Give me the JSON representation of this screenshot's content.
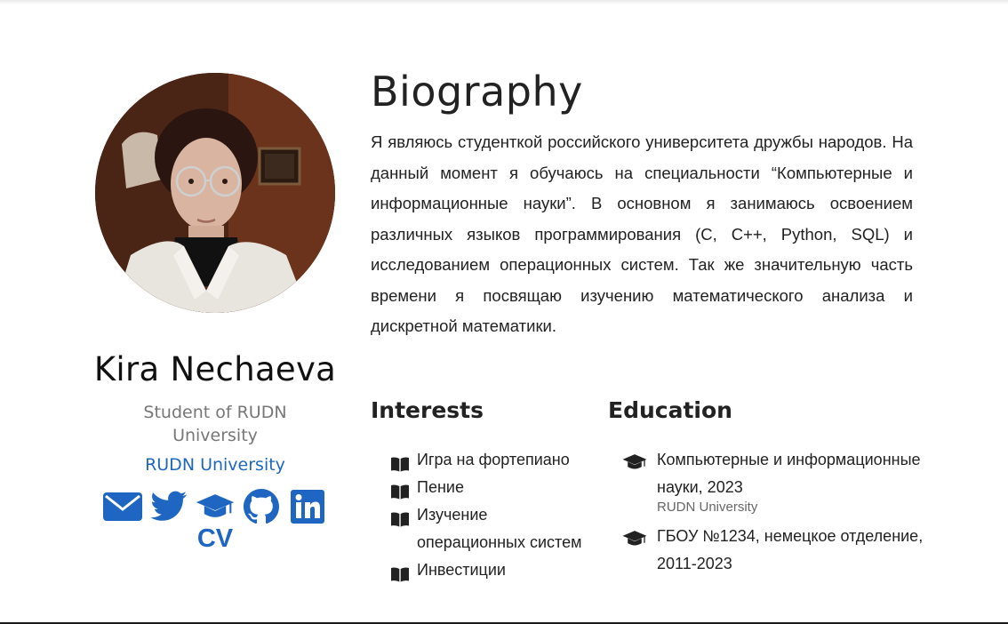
{
  "profile": {
    "name": "Kira Nechaeva",
    "role": "Student of RUDN University",
    "organization": "RUDN University",
    "cv_label": "CV",
    "socials": [
      {
        "icon": "envelope-icon"
      },
      {
        "icon": "twitter-icon"
      },
      {
        "icon": "graduation-cap-icon"
      },
      {
        "icon": "github-icon"
      },
      {
        "icon": "linkedin-icon"
      }
    ]
  },
  "biography": {
    "title": "Biography",
    "text": "Я являюсь студенткой российского университета дружбы народов. На данный момент я обучаюсь на специальности “Компьютерные и информационные науки”. В основном я занимаюсь освоением различных языков программирования (C, C++, Python, SQL) и исследованием операционных систем. Так же значительную часть времени я посвящаю изучению математического анализа и дискретной математики."
  },
  "interests": {
    "title": "Interests",
    "items": [
      "Игра на фортепиано",
      "Пение",
      "Изучение операционных систем",
      "Инвестиции"
    ]
  },
  "education": {
    "title": "Education",
    "items": [
      {
        "course": "Компьютерные и информационные науки, 2023",
        "institution": "RUDN University"
      },
      {
        "course": "ГБОУ №1234, немецкое отделение, 2011-2023",
        "institution": ""
      }
    ]
  },
  "colors": {
    "accent": "#1e66c2",
    "text": "#222222",
    "muted": "#777777"
  }
}
